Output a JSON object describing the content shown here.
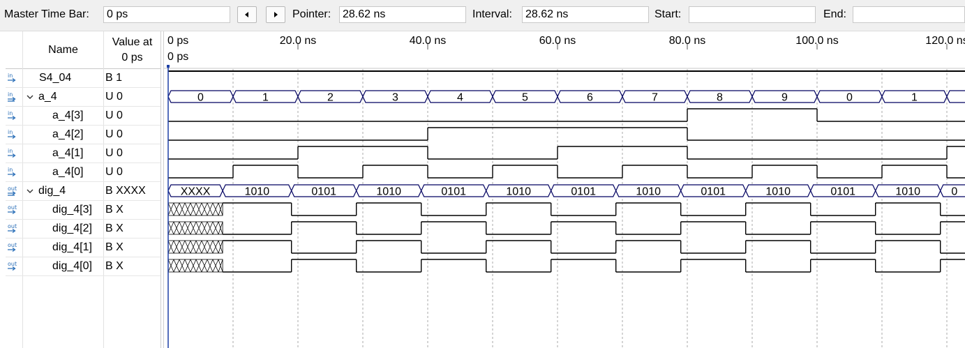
{
  "toolbar": {
    "master_time_bar_label": "Master Time Bar:",
    "master_time_bar_value": "0 ps",
    "prev_icon": "arrow-left-icon",
    "next_icon": "arrow-right-icon",
    "pointer_label": "Pointer:",
    "pointer_value": "28.62 ns",
    "interval_label": "Interval:",
    "interval_value": "28.62 ns",
    "start_label": "Start:",
    "start_value": "",
    "end_label": "End:",
    "end_value": ""
  },
  "columns": {
    "name_header": "Name",
    "value_header_line1": "Value at",
    "value_header_line2": "0 ps"
  },
  "timeline": {
    "ticks": [
      "0 ps",
      "20.0 ns",
      "40.0 ns",
      "60.0 ns",
      "80.0 ns",
      "100.0 ns",
      "120.0 ns"
    ],
    "cursor_label": "0 ps"
  },
  "signals": [
    {
      "name": "S4_04",
      "value": "B 1",
      "dir": "in",
      "kind": "bit",
      "level": 0
    },
    {
      "name": "a_4",
      "value": "U 0",
      "dir": "in-group",
      "kind": "bus",
      "level": 0,
      "expandable": true
    },
    {
      "name": "a_4[3]",
      "value": "U 0",
      "dir": "in",
      "kind": "bit",
      "level": 1
    },
    {
      "name": "a_4[2]",
      "value": "U 0",
      "dir": "in",
      "kind": "bit",
      "level": 1
    },
    {
      "name": "a_4[1]",
      "value": "U 0",
      "dir": "in",
      "kind": "bit",
      "level": 1
    },
    {
      "name": "a_4[0]",
      "value": "U 0",
      "dir": "in",
      "kind": "bit",
      "level": 1
    },
    {
      "name": "dig_4",
      "value": "B XXXX",
      "dir": "out-group",
      "kind": "bus",
      "level": 0,
      "expandable": true
    },
    {
      "name": "dig_4[3]",
      "value": "B X",
      "dir": "out",
      "kind": "bit",
      "level": 1
    },
    {
      "name": "dig_4[2]",
      "value": "B X",
      "dir": "out",
      "kind": "bit",
      "level": 1
    },
    {
      "name": "dig_4[1]",
      "value": "B X",
      "dir": "out",
      "kind": "bit",
      "level": 1
    },
    {
      "name": "dig_4[0]",
      "value": "B X",
      "dir": "out",
      "kind": "bit",
      "level": 1
    }
  ],
  "waves": {
    "time_unit": "ns",
    "period": 10,
    "a_4_values": [
      "0",
      "1",
      "2",
      "3",
      "4",
      "5",
      "6",
      "7",
      "8",
      "9",
      "0",
      "1",
      ""
    ],
    "dig_4_values": [
      "XXXX",
      "1010",
      "0101",
      "1010",
      "0101",
      "1010",
      "0101",
      "1010",
      "0101",
      "1010",
      "0101",
      "1010",
      "0"
    ],
    "S4_04": [
      [
        0,
        1
      ]
    ],
    "a_4[3]": [
      [
        0,
        0
      ],
      [
        80,
        1
      ],
      [
        100,
        0
      ]
    ],
    "a_4[2]": [
      [
        0,
        0
      ],
      [
        40,
        1
      ],
      [
        80,
        0
      ]
    ],
    "a_4[1]": [
      [
        0,
        0
      ],
      [
        20,
        1
      ],
      [
        40,
        0
      ],
      [
        60,
        1
      ],
      [
        80,
        0
      ],
      [
        120,
        1
      ]
    ],
    "a_4[0]": [
      [
        0,
        0
      ],
      [
        10,
        1
      ],
      [
        20,
        0
      ],
      [
        30,
        1
      ],
      [
        40,
        0
      ],
      [
        50,
        1
      ],
      [
        60,
        0
      ],
      [
        70,
        1
      ],
      [
        80,
        0
      ],
      [
        90,
        1
      ],
      [
        100,
        0
      ],
      [
        110,
        1
      ],
      [
        120,
        0
      ]
    ],
    "dig_4[3]": [
      [
        0,
        "X"
      ],
      [
        8.4,
        1
      ],
      [
        19,
        0
      ],
      [
        29,
        1
      ],
      [
        39,
        0
      ],
      [
        49,
        1
      ],
      [
        59,
        0
      ],
      [
        69,
        1
      ],
      [
        79,
        0
      ],
      [
        89,
        1
      ],
      [
        99,
        0
      ],
      [
        109,
        1
      ],
      [
        119,
        0
      ]
    ],
    "dig_4[2]": [
      [
        0,
        "X"
      ],
      [
        8.4,
        0
      ],
      [
        19,
        1
      ],
      [
        29,
        0
      ],
      [
        39,
        1
      ],
      [
        49,
        0
      ],
      [
        59,
        1
      ],
      [
        69,
        0
      ],
      [
        79,
        1
      ],
      [
        89,
        0
      ],
      [
        99,
        1
      ],
      [
        109,
        0
      ],
      [
        119,
        1
      ]
    ],
    "dig_4[1]": [
      [
        0,
        "X"
      ],
      [
        8.4,
        1
      ],
      [
        19,
        0
      ],
      [
        29,
        1
      ],
      [
        39,
        0
      ],
      [
        49,
        1
      ],
      [
        59,
        0
      ],
      [
        69,
        1
      ],
      [
        79,
        0
      ],
      [
        89,
        1
      ],
      [
        99,
        0
      ],
      [
        109,
        1
      ],
      [
        119,
        0
      ]
    ],
    "dig_4[0]": [
      [
        0,
        "X"
      ],
      [
        8.4,
        0
      ],
      [
        19,
        1
      ],
      [
        29,
        0
      ],
      [
        39,
        1
      ],
      [
        49,
        0
      ],
      [
        59,
        1
      ],
      [
        69,
        0
      ],
      [
        79,
        1
      ],
      [
        89,
        0
      ],
      [
        99,
        1
      ],
      [
        109,
        0
      ],
      [
        119,
        1
      ]
    ]
  },
  "colors": {
    "bus_outline": "#000060",
    "signal_line": "#000000",
    "grid_dash": "#a8a8a8",
    "cursor": "#1d3fa5",
    "in_icon": "#2b6fb8",
    "out_icon": "#2b6fb8"
  }
}
